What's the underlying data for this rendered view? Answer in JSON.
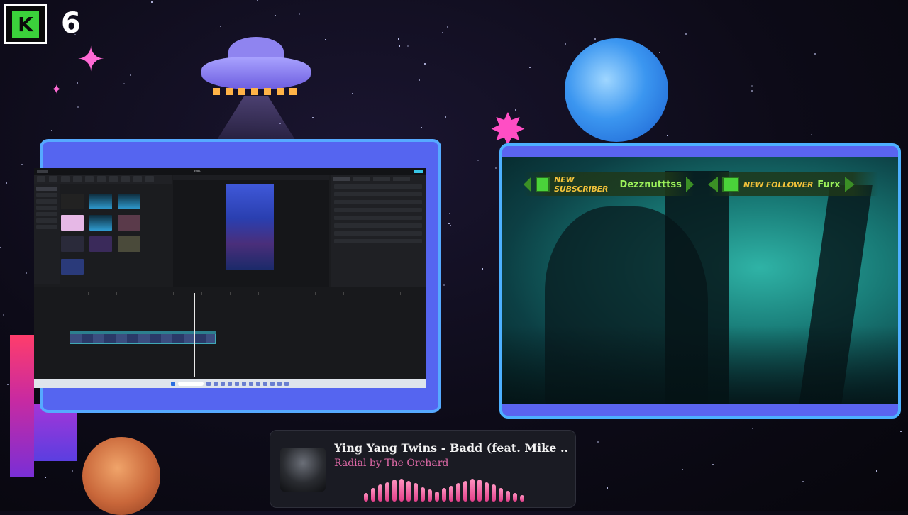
{
  "overlay": {
    "counter_value": "6",
    "logo_glyph": "K",
    "accent_color": "#56a9ff",
    "frame_color": "#5565f0"
  },
  "screen_capture": {
    "title": "CapCut video editor",
    "window_title": "0407"
  },
  "alerts": [
    {
      "type": "subscriber",
      "tag": "NEW SUBSCRIBER",
      "name": "Dezznutttss",
      "icon": "slime-icon"
    },
    {
      "type": "follower",
      "tag": "NEW FOLLOWER",
      "name": "Furx",
      "icon": "slime-icon"
    }
  ],
  "now_playing": {
    "title": "Ying Yang Twins - Badd (feat. Mike ...",
    "artist": "Radial by The Orchard",
    "visualizer_levels": [
      0.35,
      0.55,
      0.7,
      0.8,
      0.9,
      0.95,
      0.85,
      0.75,
      0.6,
      0.5,
      0.4,
      0.55,
      0.65,
      0.75,
      0.85,
      0.95,
      0.9,
      0.8,
      0.7,
      0.55,
      0.45,
      0.35,
      0.25
    ]
  }
}
